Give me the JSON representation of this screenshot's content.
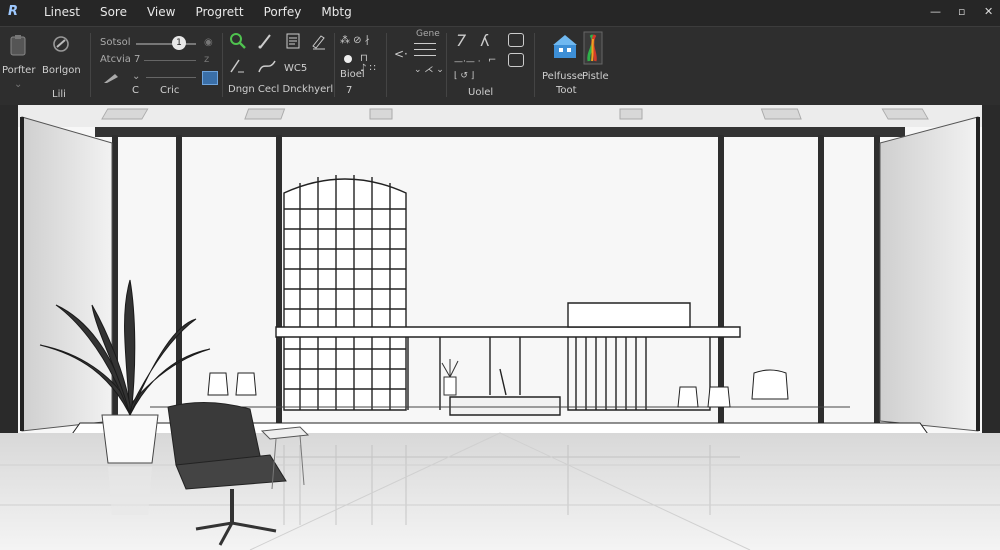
{
  "app": {
    "logo": "R"
  },
  "menu": [
    "Linest",
    "Sore",
    "View",
    "Progrett",
    "Porfey",
    "Mbtg"
  ],
  "window_controls": {
    "minimize": "—",
    "maximize": "▫",
    "close": "✕"
  },
  "ribbon": {
    "portfolio_label": "Porfter",
    "design_label": "Borlgon",
    "design_sub": "Lili",
    "slider_label": "Sotsol",
    "slider_value": "1",
    "axis_label": "Atcvia",
    "axis_value": "7",
    "axis_unit": "z",
    "bottom_left": "C",
    "bottom_mid": "Cric",
    "draw_group_label": "Dngn Cecl Dnckhyerl",
    "wcs_label": "WC5",
    "block_label": "Bioel",
    "block_num": "7",
    "gene_label": "Gene",
    "model_label": "Uolel",
    "palette_label": "Pelfusse",
    "palette_sub": "Toot",
    "profile_label": "Pistle"
  },
  "colors": {
    "accent": "#2f8fd6",
    "profile_red": "#d23a2a",
    "profile_green": "#2fb24a",
    "profile_orange": "#f0a020"
  }
}
